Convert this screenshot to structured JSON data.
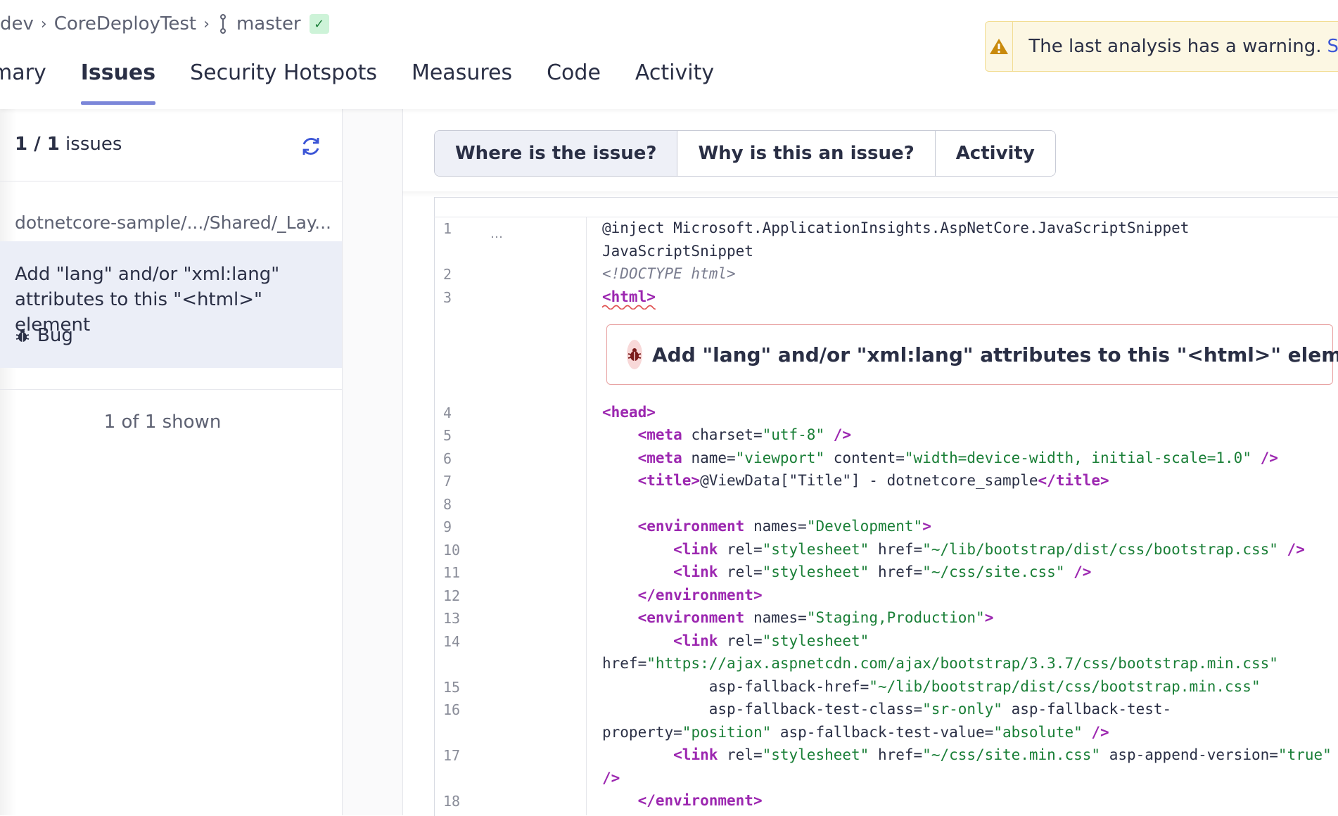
{
  "breadcrumb": {
    "items": [
      "dev",
      "CoreDeployTest"
    ],
    "branch": "master"
  },
  "nav": {
    "tabs": [
      "Summary",
      "Issues",
      "Security Hotspots",
      "Measures",
      "Code",
      "Activity"
    ],
    "active": "Issues",
    "summary_visible": "mary"
  },
  "warning": {
    "text": "The last analysis has a warning.",
    "link": "Se"
  },
  "issues_panel": {
    "count_current": "1 / 1",
    "count_label": " issues",
    "file_path": "dotnetcore-sample/.../Shared/_Lay...",
    "issue_title": "Add \"lang\" and/or \"xml:lang\" attributes to this \"<html>\" element",
    "issue_type": "Bug",
    "shown": "1 of 1 shown"
  },
  "detail_tabs": [
    "Where is the issue?",
    "Why is this an issue?",
    "Activity"
  ],
  "inline_issue": "Add \"lang\" and/or \"xml:lang\" attributes to this \"<html>\" element",
  "code_lines": {
    "ellipsis": "…",
    "l1a": "@inject Microsoft.ApplicationInsights.AspNetCore.JavaScriptSnippet",
    "l1b": "JavaScriptSnippet",
    "l2": "<!DOCTYPE html>",
    "l3": "<html>",
    "l4": "<head>",
    "l5_tag": "<meta",
    "l5_attr": " charset=",
    "l5_val": "\"utf-8\"",
    "l5_end": " />",
    "l6_tag": "<meta",
    "l6_attr1": " name=",
    "l6_val1": "\"viewport\"",
    "l6_attr2": " content=",
    "l6_val2": "\"width=device-width, initial-scale=1.0\"",
    "l6_end": " />",
    "l7_tag": "<title>",
    "l7_text": "@ViewData[\"Title\"] - dotnetcore_sample",
    "l7_close": "</title>",
    "l9_tag": "<environment",
    "l9_attr": " names=",
    "l9_val": "\"Development\"",
    "l9_end": ">",
    "l10_tag": "<link",
    "l10_attr1": " rel=",
    "l10_val1": "\"stylesheet\"",
    "l10_attr2": " href=",
    "l10_val2": "\"~/lib/bootstrap/dist/css/bootstrap.css\"",
    "l10_end": " />",
    "l11_tag": "<link",
    "l11_attr1": " rel=",
    "l11_val1": "\"stylesheet\"",
    "l11_attr2": " href=",
    "l11_val2": "\"~/css/site.css\"",
    "l11_end": " />",
    "l12": "</environment>",
    "l13_tag": "<environment",
    "l13_attr": " names=",
    "l13_val": "\"Staging,Production\"",
    "l13_end": ">",
    "l14_tag": "<link",
    "l14_attr": " rel=",
    "l14_val": "\"stylesheet\"",
    "l14b_attr": "href=",
    "l14b_val": "\"https://ajax.aspnetcdn.com/ajax/bootstrap/3.3.7/css/bootstrap.min.css\"",
    "l15_attr": "asp-fallback-href=",
    "l15_val": "\"~/lib/bootstrap/dist/css/bootstrap.min.css\"",
    "l16_attr1": "asp-fallback-test-class=",
    "l16_val1": "\"sr-only\"",
    "l16_attr2": " asp-fallback-test-",
    "l16b_attr": "property=",
    "l16b_val": "\"position\"",
    "l16b_attr2": " asp-fallback-test-value=",
    "l16b_val2": "\"absolute\"",
    "l16b_end": " />",
    "l17_tag": "<link",
    "l17_attr1": " rel=",
    "l17_val1": "\"stylesheet\"",
    "l17_attr2": " href=",
    "l17_val2": "\"~/css/site.min.css\"",
    "l17_attr3": " asp-append-version=",
    "l17_val3": "\"true\"",
    "l17b_end": "/>",
    "l18": "</environment>"
  },
  "line_numbers": [
    "1",
    "2",
    "3",
    "4",
    "5",
    "6",
    "7",
    "8",
    "9",
    "10",
    "11",
    "12",
    "13",
    "14",
    "15",
    "16",
    "17",
    "18"
  ],
  "colors": {
    "accent": "#7b86d9",
    "tag": "#9c27b0",
    "string": "#1a7f37",
    "warning_bg": "#fcf7e3",
    "issue_border": "#e8a2a2"
  }
}
